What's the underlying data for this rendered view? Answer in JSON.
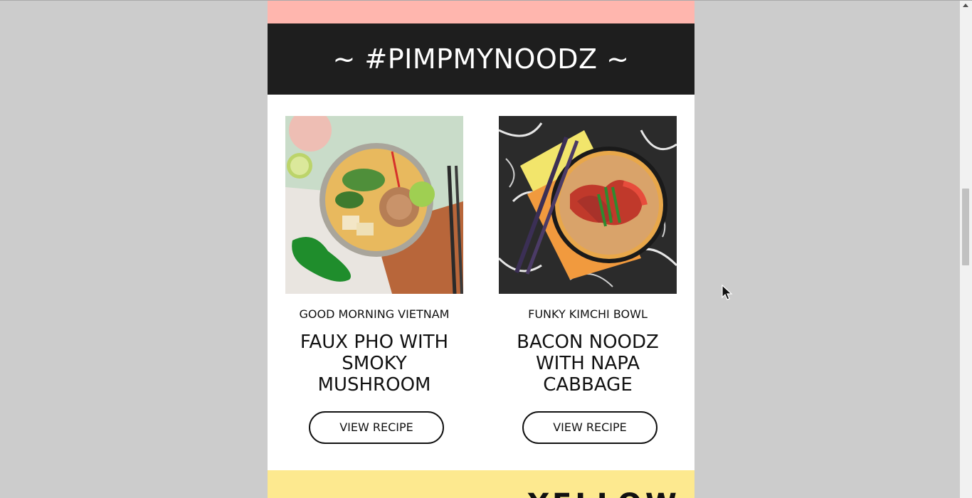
{
  "banner": {
    "title": "~ #PIMPMYNOODZ ~"
  },
  "recipes": [
    {
      "kicker": "GOOD MORNING VIETNAM",
      "title": "FAUX PHO WITH SMOKY MUSHROOM",
      "button_label": "VIEW RECIPE",
      "image_icon": "pho-bowl-photo"
    },
    {
      "kicker": "FUNKY KIMCHI BOWL",
      "title": "BACON NOODZ WITH NAPA CABBAGE",
      "button_label": "VIEW RECIPE",
      "image_icon": "kimchi-bowl-photo"
    }
  ],
  "next_section": {
    "title": "YELLOW"
  },
  "colors": {
    "page_bg": "#cccccc",
    "pink_band": "#ffb6ae",
    "dark_banner": "#1e1e1e",
    "yellow_band": "#fde98f"
  }
}
